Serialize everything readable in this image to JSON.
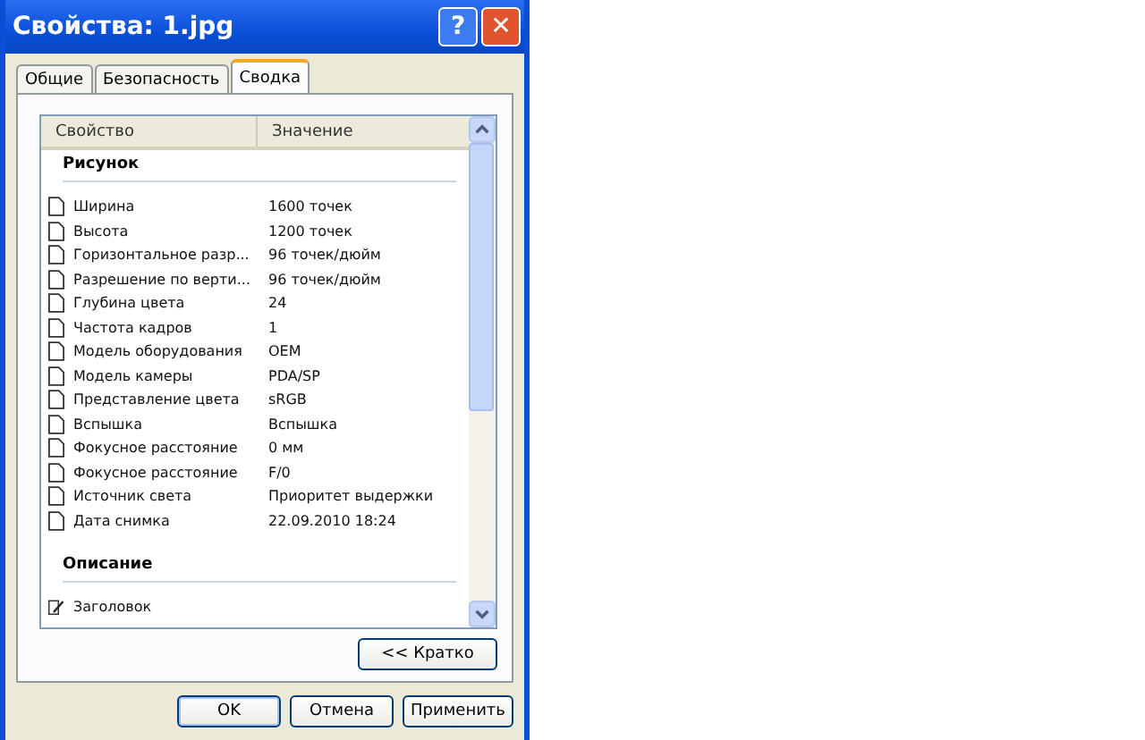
{
  "window": {
    "title": "Свойства: 1.jpg",
    "help_button": "?",
    "close_button": "✕"
  },
  "tabs": [
    {
      "label": "Общие",
      "selected": false
    },
    {
      "label": "Безопасность",
      "selected": false
    },
    {
      "label": "Сводка",
      "selected": true
    }
  ],
  "table": {
    "columns": [
      "Свойство",
      "Значение"
    ],
    "groups": [
      {
        "title": "Рисунок",
        "rows": [
          {
            "kind": "page",
            "name": "Ширина",
            "value": "1600 точек"
          },
          {
            "kind": "page",
            "name": "Высота",
            "value": "1200 точек"
          },
          {
            "kind": "page",
            "name": "Горизонтальное разр...",
            "value": "96 точек/дюйм"
          },
          {
            "kind": "page",
            "name": "Разрешение по верти...",
            "value": "96 точек/дюйм"
          },
          {
            "kind": "page",
            "name": "Глубина цвета",
            "value": "24"
          },
          {
            "kind": "page",
            "name": "Частота кадров",
            "value": "1"
          },
          {
            "kind": "page",
            "name": "Модель оборудования",
            "value": "OEM"
          },
          {
            "kind": "page",
            "name": "Модель камеры",
            "value": "PDA/SP"
          },
          {
            "kind": "page",
            "name": "Представление цвета",
            "value": "sRGB"
          },
          {
            "kind": "page",
            "name": "Вспышка",
            "value": "Вспышка"
          },
          {
            "kind": "page",
            "name": "Фокусное расстояние",
            "value": "0 мм"
          },
          {
            "kind": "page",
            "name": "Фокусное расстояние",
            "value": "F/0"
          },
          {
            "kind": "page",
            "name": "Источник света",
            "value": "Приоритет выдержки"
          },
          {
            "kind": "page",
            "name": "Дата снимка",
            "value": "22.09.2010 18:24"
          }
        ]
      },
      {
        "title": "Описание",
        "rows": [
          {
            "kind": "editable",
            "name": "Заголовок"
          }
        ]
      }
    ]
  },
  "toggle_button": "<< Кратко",
  "buttons": [
    "OK",
    "Отмена",
    "Применить"
  ]
}
